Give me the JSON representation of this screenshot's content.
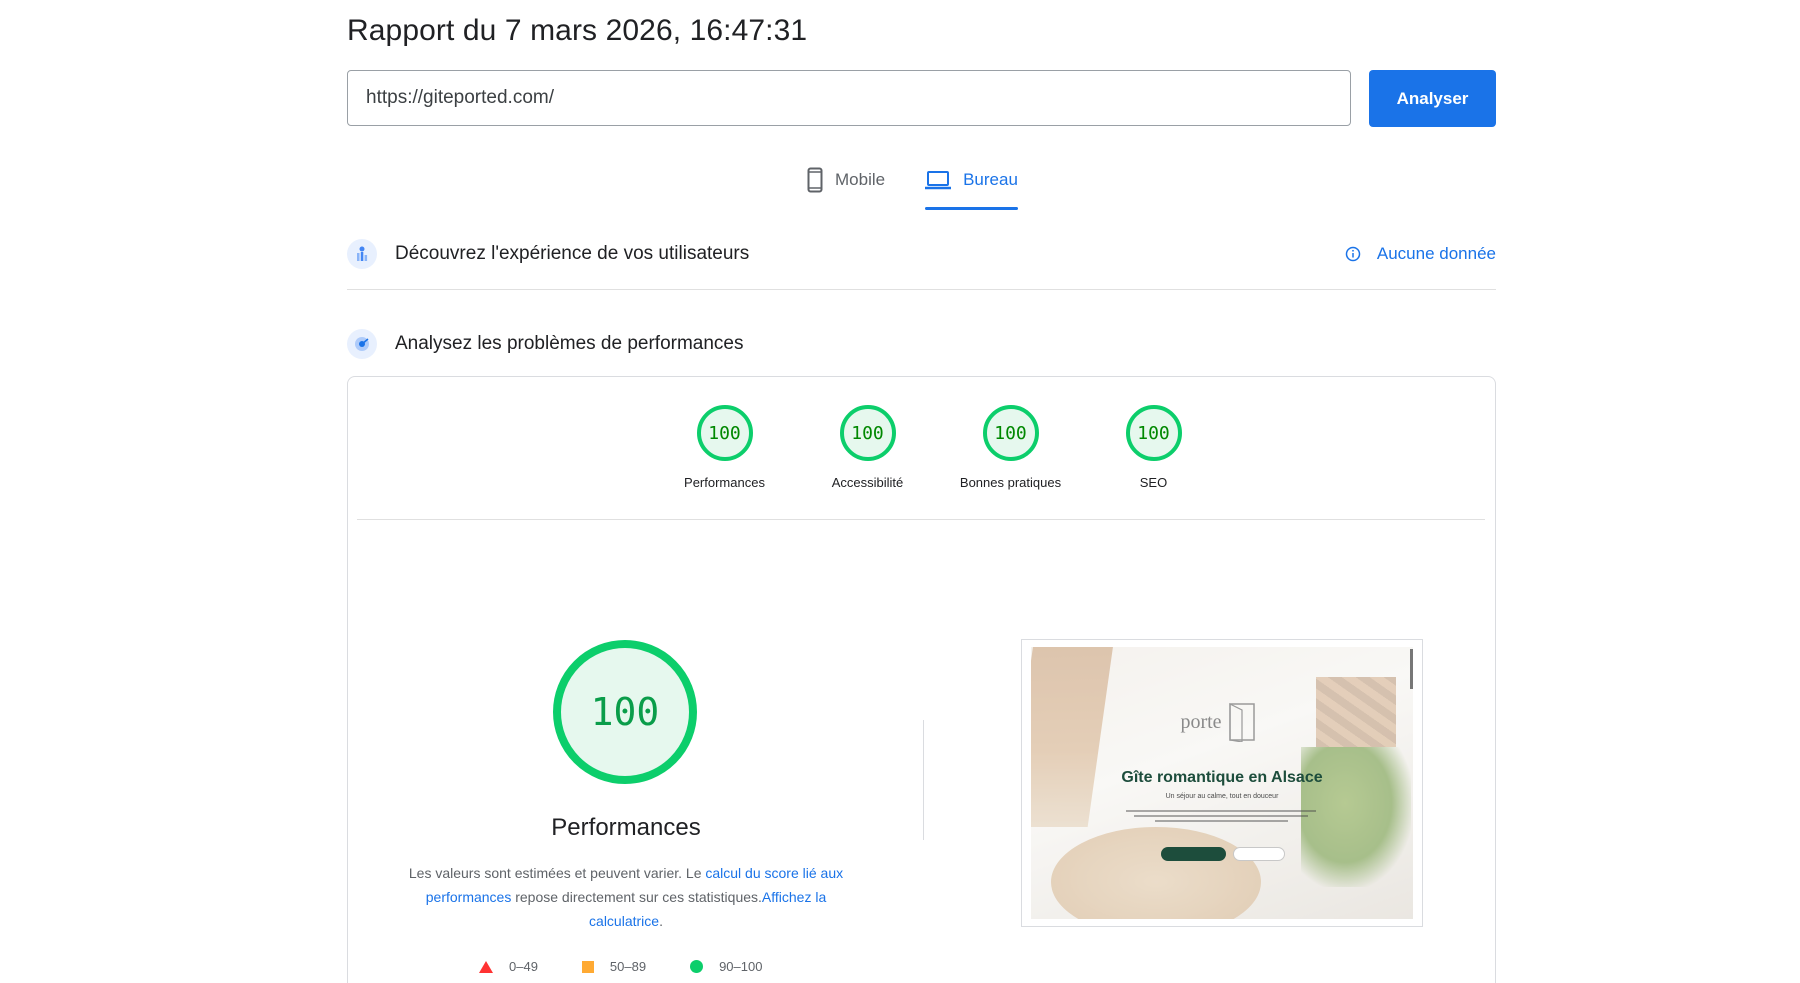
{
  "header": {
    "report_title": "Rapport du 7 mars 2026, 16:47:31"
  },
  "search": {
    "url_value": "https://giteported.com/",
    "analyze_label": "Analyser"
  },
  "tabs": [
    {
      "label": "Mobile",
      "icon": "smartphone-icon",
      "active": false
    },
    {
      "label": "Bureau",
      "icon": "laptop-icon",
      "active": true
    }
  ],
  "crux_section": {
    "title": "Découvrez l'expérience de vos utilisateurs",
    "icon": "user-experience-icon",
    "status_label": "Aucune donnée",
    "status_icon": "info-icon"
  },
  "lab_section": {
    "title": "Analysez les problèmes de performances",
    "icon": "lighthouse-icon"
  },
  "category_scores": [
    {
      "label": "Performances",
      "score": "100"
    },
    {
      "label": "Accessibilité",
      "score": "100"
    },
    {
      "label": "Bonnes pratiques",
      "score": "100"
    },
    {
      "label": "SEO",
      "score": "100"
    }
  ],
  "performance_detail": {
    "score": "100",
    "title": "Performances",
    "note_prefix": "Les valeurs sont estimées et peuvent varier. Le ",
    "note_link1": "calcul du score lié aux performances",
    "note_middle": " repose directement sur ces statistiques.",
    "note_link2": "Affichez la calculatrice",
    "note_suffix": "."
  },
  "legend": [
    {
      "range": "0–49",
      "shape": "triangle",
      "color": "#ff3333"
    },
    {
      "range": "50–89",
      "shape": "square",
      "color": "#ffaa33"
    },
    {
      "range": "90–100",
      "shape": "circle",
      "color": "#0cce6b"
    }
  ],
  "screenshot": {
    "logo_text": "porte",
    "heading": "Gîte romantique en Alsace",
    "subheading": "Un séjour au calme, tout en douceur"
  },
  "colors": {
    "accent": "#1a73e8",
    "pass_green": "#0cce6b",
    "pass_text": "#008800"
  }
}
